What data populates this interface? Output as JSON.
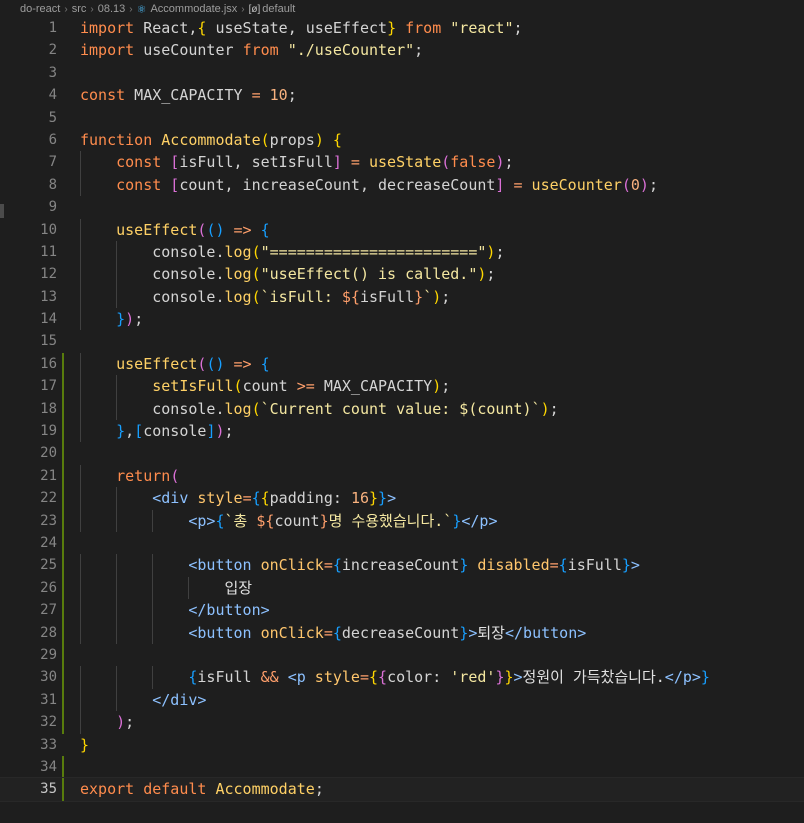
{
  "breadcrumb": {
    "items": [
      "do-react",
      "src",
      "08.13",
      "Accommodate.jsx",
      "default"
    ]
  },
  "editor": {
    "current_line": 35,
    "lines": [
      {
        "n": "1",
        "tokens": [
          [
            "kw",
            "import"
          ],
          [
            "id",
            " React,"
          ],
          [
            "br1",
            "{"
          ],
          [
            "id",
            " useState, useEffect"
          ],
          [
            "br1",
            "}"
          ],
          [
            "kw",
            " from "
          ],
          [
            "str",
            "\"react\""
          ],
          [
            "id",
            ";"
          ]
        ]
      },
      {
        "n": "2",
        "tokens": [
          [
            "kw",
            "import"
          ],
          [
            "id",
            " useCounter "
          ],
          [
            "kw",
            "from"
          ],
          [
            "str",
            " \"./useCounter\""
          ],
          [
            "id",
            ";"
          ]
        ]
      },
      {
        "n": "3",
        "tokens": []
      },
      {
        "n": "4",
        "tokens": [
          [
            "kw",
            "const"
          ],
          [
            "id",
            " MAX_CAPACITY "
          ],
          [
            "op",
            "="
          ],
          [
            "num",
            " 10"
          ],
          [
            "id",
            ";"
          ]
        ]
      },
      {
        "n": "5",
        "tokens": []
      },
      {
        "n": "6",
        "tokens": [
          [
            "kw",
            "function"
          ],
          [
            "fn",
            " Accommodate"
          ],
          [
            "br1",
            "("
          ],
          [
            "id",
            "props"
          ],
          [
            "br1",
            ")"
          ],
          [
            "br1",
            " {"
          ]
        ]
      },
      {
        "n": "7",
        "tokens": [
          [
            "id",
            "    "
          ],
          [
            "kw",
            "const"
          ],
          [
            "br2",
            " ["
          ],
          [
            "id",
            "isFull, setIsFull"
          ],
          [
            "br2",
            "]"
          ],
          [
            "op",
            " ="
          ],
          [
            "fn",
            " useState"
          ],
          [
            "br2",
            "("
          ],
          [
            "kw",
            "false"
          ],
          [
            "br2",
            ")"
          ],
          [
            "id",
            ";"
          ]
        ]
      },
      {
        "n": "8",
        "tokens": [
          [
            "id",
            "    "
          ],
          [
            "kw",
            "const"
          ],
          [
            "br2",
            " ["
          ],
          [
            "id",
            "count, increaseCount, decreaseCount"
          ],
          [
            "br2",
            "]"
          ],
          [
            "op",
            " ="
          ],
          [
            "fn",
            " useCounter"
          ],
          [
            "br2",
            "("
          ],
          [
            "num",
            "0"
          ],
          [
            "br2",
            ")"
          ],
          [
            "id",
            ";"
          ]
        ]
      },
      {
        "n": "9",
        "tokens": []
      },
      {
        "n": "10",
        "tokens": [
          [
            "id",
            "    "
          ],
          [
            "fn",
            "useEffect"
          ],
          [
            "br2",
            "("
          ],
          [
            "br3",
            "()"
          ],
          [
            "op",
            " =>"
          ],
          [
            "br3",
            " {"
          ]
        ]
      },
      {
        "n": "11",
        "tokens": [
          [
            "id",
            "        console."
          ],
          [
            "fn",
            "log"
          ],
          [
            "br1",
            "("
          ],
          [
            "str",
            "\"=======================\""
          ],
          [
            "br1",
            ")"
          ],
          [
            "id",
            ";"
          ]
        ]
      },
      {
        "n": "12",
        "tokens": [
          [
            "id",
            "        console."
          ],
          [
            "fn",
            "log"
          ],
          [
            "br1",
            "("
          ],
          [
            "str",
            "\"useEffect() is called.\""
          ],
          [
            "br1",
            ")"
          ],
          [
            "id",
            ";"
          ]
        ]
      },
      {
        "n": "13",
        "tokens": [
          [
            "id",
            "        console."
          ],
          [
            "fn",
            "log"
          ],
          [
            "br1",
            "("
          ],
          [
            "str",
            "`isFull: "
          ],
          [
            "op",
            "${"
          ],
          [
            "id",
            "isFull"
          ],
          [
            "op",
            "}"
          ],
          [
            "str",
            "`"
          ],
          [
            "br1",
            ")"
          ],
          [
            "id",
            ";"
          ]
        ]
      },
      {
        "n": "14",
        "tokens": [
          [
            "id",
            "    "
          ],
          [
            "br3",
            "}"
          ],
          [
            "br2",
            ")"
          ],
          [
            "id",
            ";"
          ]
        ]
      },
      {
        "n": "15",
        "tokens": []
      },
      {
        "n": "16",
        "mark": true,
        "tokens": [
          [
            "id",
            "    "
          ],
          [
            "fn",
            "useEffect"
          ],
          [
            "br2",
            "("
          ],
          [
            "br3",
            "()"
          ],
          [
            "op",
            " =>"
          ],
          [
            "br3",
            " {"
          ]
        ]
      },
      {
        "n": "17",
        "mark": true,
        "tokens": [
          [
            "id",
            "        "
          ],
          [
            "fn",
            "setIsFull"
          ],
          [
            "br1",
            "("
          ],
          [
            "id",
            "count "
          ],
          [
            "op",
            ">="
          ],
          [
            "id",
            " MAX_CAPACITY"
          ],
          [
            "br1",
            ")"
          ],
          [
            "id",
            ";"
          ]
        ]
      },
      {
        "n": "18",
        "mark": true,
        "tokens": [
          [
            "id",
            "        console."
          ],
          [
            "fn",
            "log"
          ],
          [
            "br1",
            "("
          ],
          [
            "str",
            "`Current count value: $(count)`"
          ],
          [
            "br1",
            ")"
          ],
          [
            "id",
            ";"
          ]
        ]
      },
      {
        "n": "19",
        "mark": true,
        "tokens": [
          [
            "id",
            "    "
          ],
          [
            "br3",
            "}"
          ],
          [
            "id",
            ","
          ],
          [
            "br3",
            "["
          ],
          [
            "id",
            "console"
          ],
          [
            "br3",
            "]"
          ],
          [
            "br2",
            ")"
          ],
          [
            "id",
            ";"
          ]
        ]
      },
      {
        "n": "20",
        "mark": true,
        "tokens": []
      },
      {
        "n": "21",
        "mark": true,
        "tokens": [
          [
            "id",
            "    "
          ],
          [
            "kw",
            "return"
          ],
          [
            "br2",
            "("
          ]
        ]
      },
      {
        "n": "22",
        "mark": true,
        "tokens": [
          [
            "id",
            "        "
          ],
          [
            "tag",
            "<div"
          ],
          [
            "attr",
            " style"
          ],
          [
            "op",
            "="
          ],
          [
            "br3",
            "{"
          ],
          [
            "br1",
            "{"
          ],
          [
            "id",
            "padding: "
          ],
          [
            "num",
            "16"
          ],
          [
            "br1",
            "}"
          ],
          [
            "br3",
            "}"
          ],
          [
            "tag",
            ">"
          ]
        ]
      },
      {
        "n": "23",
        "mark": true,
        "tokens": [
          [
            "id",
            "            "
          ],
          [
            "tag",
            "<p>"
          ],
          [
            "br3",
            "{"
          ],
          [
            "str",
            "`총 "
          ],
          [
            "op",
            "${"
          ],
          [
            "id",
            "count"
          ],
          [
            "op",
            "}"
          ],
          [
            "str",
            "명 수용했습니다.`"
          ],
          [
            "br3",
            "}"
          ],
          [
            "tag",
            "</p>"
          ]
        ]
      },
      {
        "n": "24",
        "mark": true,
        "tokens": []
      },
      {
        "n": "25",
        "mark": true,
        "tokens": [
          [
            "id",
            "            "
          ],
          [
            "tag",
            "<button"
          ],
          [
            "attr",
            " onClick"
          ],
          [
            "op",
            "="
          ],
          [
            "br3",
            "{"
          ],
          [
            "id",
            "increaseCount"
          ],
          [
            "br3",
            "}"
          ],
          [
            "attr",
            " disabled"
          ],
          [
            "op",
            "="
          ],
          [
            "br3",
            "{"
          ],
          [
            "id",
            "isFull"
          ],
          [
            "br3",
            "}"
          ],
          [
            "tag",
            ">"
          ]
        ]
      },
      {
        "n": "26",
        "mark": true,
        "tokens": [
          [
            "txt",
            "                입장"
          ]
        ]
      },
      {
        "n": "27",
        "mark": true,
        "tokens": [
          [
            "id",
            "            "
          ],
          [
            "tag",
            "</button>"
          ]
        ]
      },
      {
        "n": "28",
        "mark": true,
        "tokens": [
          [
            "id",
            "            "
          ],
          [
            "tag",
            "<button"
          ],
          [
            "attr",
            " onClick"
          ],
          [
            "op",
            "="
          ],
          [
            "br3",
            "{"
          ],
          [
            "id",
            "decreaseCount"
          ],
          [
            "br3",
            "}"
          ],
          [
            "tag",
            ">"
          ],
          [
            "txt",
            "퇴장"
          ],
          [
            "tag",
            "</button>"
          ]
        ]
      },
      {
        "n": "29",
        "mark": true,
        "tokens": []
      },
      {
        "n": "30",
        "mark": true,
        "tokens": [
          [
            "id",
            "            "
          ],
          [
            "br3",
            "{"
          ],
          [
            "id",
            "isFull "
          ],
          [
            "op",
            "&&"
          ],
          [
            "tag",
            " <p"
          ],
          [
            "attr",
            " style"
          ],
          [
            "op",
            "="
          ],
          [
            "br1",
            "{"
          ],
          [
            "br2",
            "{"
          ],
          [
            "id",
            "color: "
          ],
          [
            "str",
            "'red'"
          ],
          [
            "br2",
            "}"
          ],
          [
            "br1",
            "}"
          ],
          [
            "tag",
            ">"
          ],
          [
            "txt",
            "정원이 가득찼습니다."
          ],
          [
            "tag",
            "</p>"
          ],
          [
            "br3",
            "}"
          ]
        ]
      },
      {
        "n": "31",
        "mark": true,
        "tokens": [
          [
            "id",
            "        "
          ],
          [
            "tag",
            "</div>"
          ]
        ]
      },
      {
        "n": "32",
        "mark": true,
        "tokens": [
          [
            "id",
            "    "
          ],
          [
            "br2",
            ")"
          ],
          [
            "id",
            ";"
          ]
        ]
      },
      {
        "n": "33",
        "tokens": [
          [
            "br1",
            "}"
          ]
        ]
      },
      {
        "n": "34",
        "mark": true,
        "tokens": []
      },
      {
        "n": "35",
        "mark": true,
        "tokens": [
          [
            "kw",
            "export"
          ],
          [
            "kw",
            " default"
          ],
          [
            "fn",
            " Accommodate"
          ],
          [
            "id",
            ";"
          ]
        ]
      }
    ]
  }
}
